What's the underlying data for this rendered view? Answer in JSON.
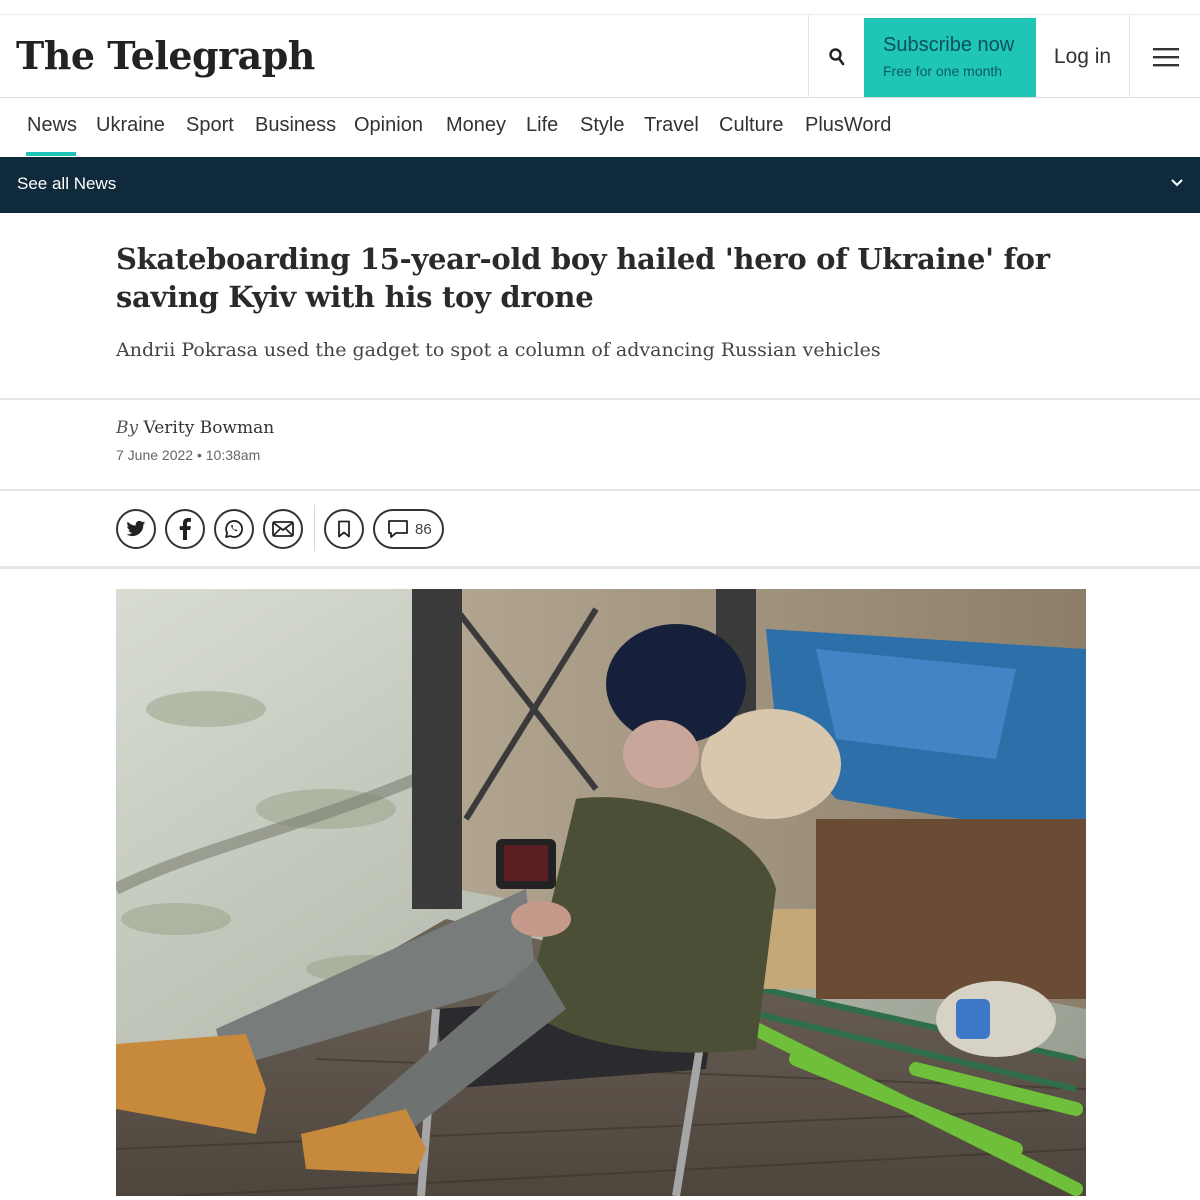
{
  "header": {
    "logo_text": "The Telegraph",
    "subscribe_label": "Subscribe now",
    "subscribe_sublabel": "Free for one month",
    "login_label": "Log in",
    "accent_color": "#1fc6b5"
  },
  "nav": {
    "items": [
      "News",
      "Ukraine",
      "Sport",
      "Business",
      "Opinion",
      "Money",
      "Life",
      "Style",
      "Travel",
      "Culture",
      "PlusWord"
    ],
    "active": "News"
  },
  "section_bar": {
    "label": "See all News",
    "background": "#0e2a3b"
  },
  "article": {
    "headline": "Skateboarding 15-year-old boy hailed 'hero of Ukraine' for saving Kyiv with his toy drone",
    "standfirst": "Andrii Pokrasa used the gadget to spot a column of advancing Russian vehicles",
    "byline_prefix": "By",
    "author": "Verity Bowman",
    "date": "7 June 2022 • 10:38am",
    "comment_count": "86"
  },
  "share": {
    "icons": [
      "twitter-icon",
      "facebook-icon",
      "whatsapp-icon",
      "email-icon",
      "bookmark-icon",
      "comment-icon"
    ]
  }
}
